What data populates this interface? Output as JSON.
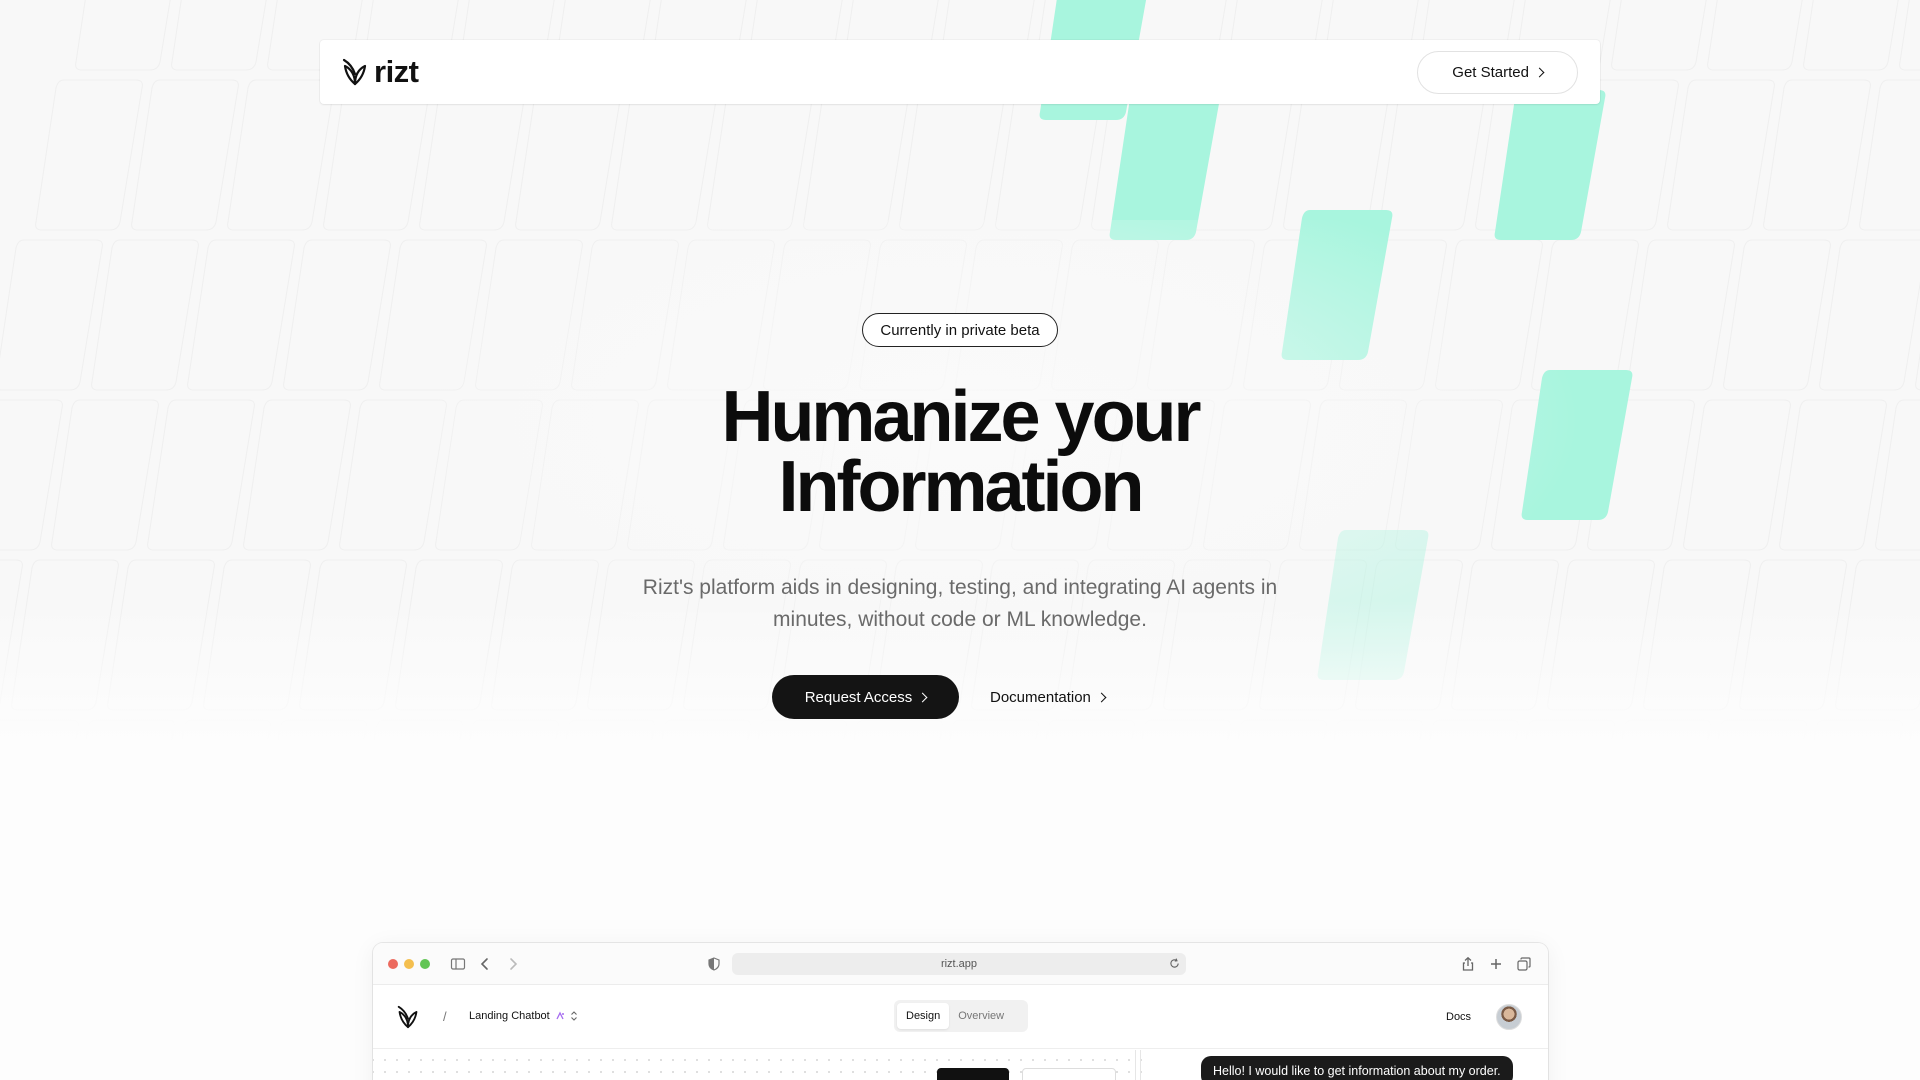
{
  "brand": {
    "name": "rizt",
    "accent": "#a8f5de"
  },
  "header": {
    "cta_label": "Get Started"
  },
  "hero": {
    "badge": "Currently in private beta",
    "title_line1": "Humanize your",
    "title_line2": "Information",
    "subtitle_line1": "Rizt's platform aids in designing, testing, and integrating AI agents in",
    "subtitle_line2": "minutes, without code or ML knowledge.",
    "primary_cta": "Request Access",
    "secondary_cta": "Documentation"
  },
  "browser": {
    "url": "rizt.app",
    "traffic_lights": [
      "#ec6a5e",
      "#f4bf4f",
      "#61c554"
    ],
    "app": {
      "project_name": "Landing Chatbot",
      "tabs": [
        {
          "label": "Design",
          "active": true
        },
        {
          "label": "Overview",
          "active": false
        }
      ],
      "docs_label": "Docs",
      "chat_message": "Hello! I would like to get information about my order."
    }
  }
}
